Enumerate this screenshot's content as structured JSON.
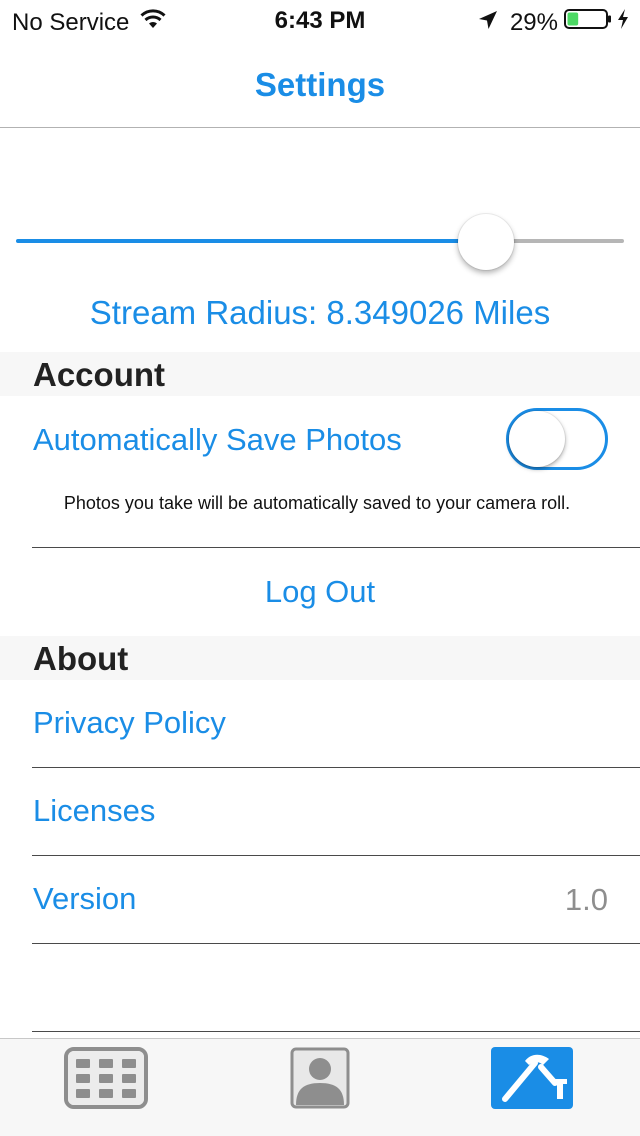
{
  "status_bar": {
    "carrier": "No Service",
    "time": "6:43 PM",
    "battery_percent": "29%",
    "battery_level": 0.29,
    "icons": [
      "wifi-icon",
      "location-arrow-icon",
      "battery-icon",
      "charging-bolt-icon"
    ]
  },
  "nav": {
    "title": "Settings"
  },
  "stream": {
    "slider_value": 0.8,
    "radius_label": "Stream Radius: 8.349026 Miles"
  },
  "account": {
    "header": "Account",
    "auto_save_label": "Automatically Save Photos",
    "auto_save_on": false,
    "auto_save_note": "Photos you take will be automatically saved to your camera roll.",
    "logout_label": "Log Out"
  },
  "about": {
    "header": "About",
    "privacy_label": "Privacy Policy",
    "licenses_label": "Licenses",
    "version_label": "Version",
    "version_value": "1.0"
  },
  "tab_bar": {
    "tabs": [
      {
        "icon": "grid-icon",
        "selected": false
      },
      {
        "icon": "person-icon",
        "selected": false
      },
      {
        "icon": "hammer-icon",
        "selected": true
      }
    ]
  },
  "colors": {
    "accent": "#1a8de6",
    "section_bg": "#f7f7f7",
    "divider": "#4a4a4a",
    "secondary_text": "#8e8e8e",
    "battery_fill": "#4cd964"
  }
}
